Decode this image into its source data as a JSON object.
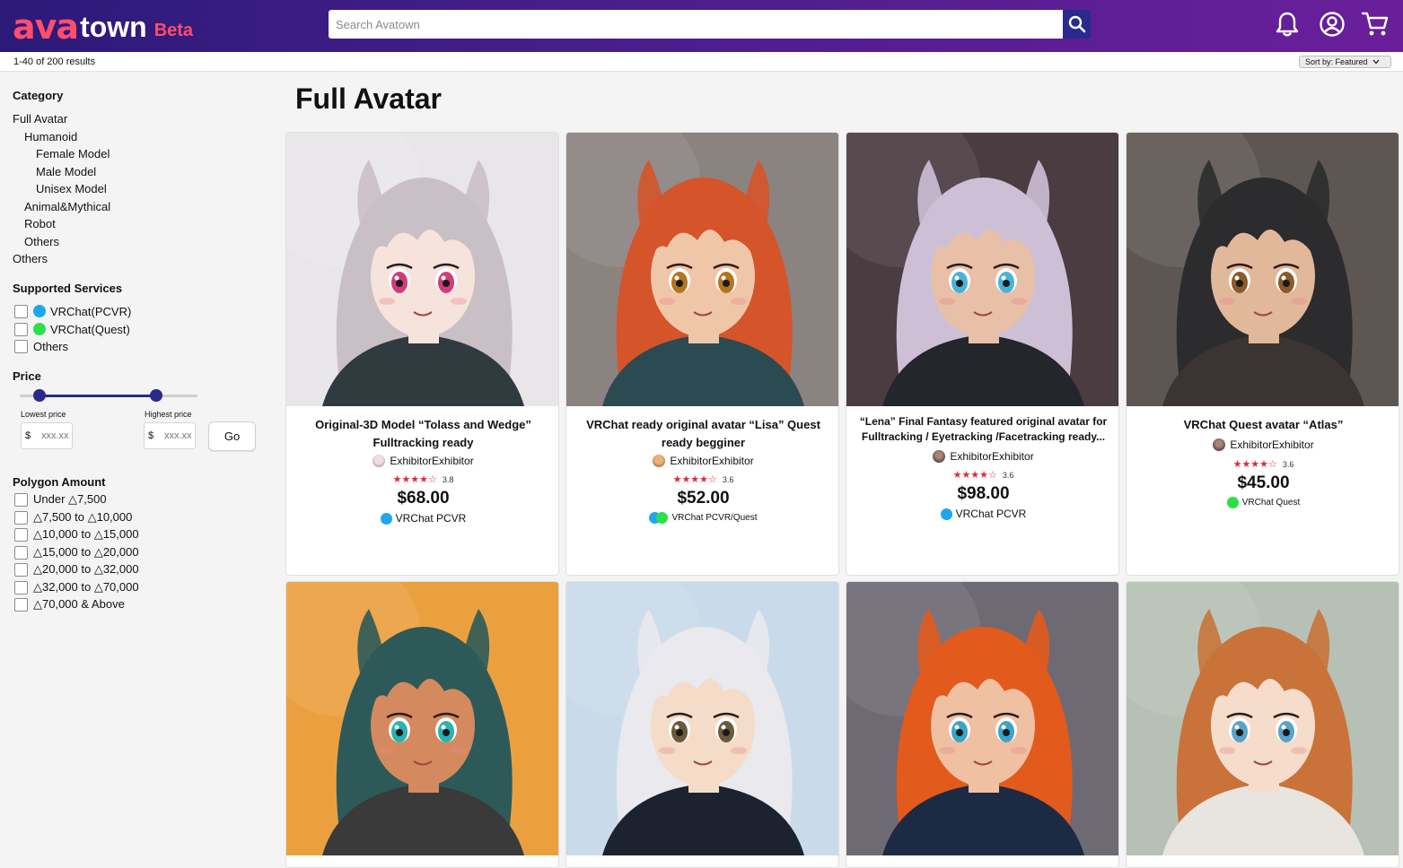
{
  "header": {
    "logo_ava": "ava",
    "logo_town": "town",
    "logo_beta": "Beta",
    "search_placeholder": "Search Avatown",
    "icons": [
      "search-icon",
      "bell-icon",
      "account-icon",
      "cart-icon"
    ]
  },
  "results": {
    "count_text": "1-40 of 200 results",
    "sort_label": "Sort by: Featured"
  },
  "sidebar": {
    "category_heading": "Category",
    "categories": [
      {
        "label": "Full Avatar",
        "level": 0
      },
      {
        "label": "Humanoid",
        "level": 1
      },
      {
        "label": "Female Model",
        "level": 2
      },
      {
        "label": "Male Model",
        "level": 2
      },
      {
        "label": "Unisex Model",
        "level": 2
      },
      {
        "label": "Animal&Mythical",
        "level": 1
      },
      {
        "label": "Robot",
        "level": 1
      },
      {
        "label": "Others",
        "level": 1
      },
      {
        "label": "Others",
        "level": 0
      }
    ],
    "services_heading": "Supported Services",
    "services": [
      {
        "label": "VRChat(PCVR)",
        "color": "#1ea7ef"
      },
      {
        "label": "VRChat(Quest)",
        "color": "#2be04a"
      },
      {
        "label": "Others",
        "color": ""
      }
    ],
    "price_heading": "Price",
    "price_slider": {
      "low_fraction": 0.11,
      "high_fraction": 0.77
    },
    "lowest_price_label": "Lowest price",
    "highest_price_label": "Highest price",
    "currency": "$",
    "price_placeholder": "xxx.xx",
    "go_label": "Go",
    "polygon_heading": "Polygon Amount",
    "polygons": [
      "Under △7,500",
      "△7,500 to △10,000",
      "△10,000 to △15,000",
      "△15,000 to △20,000",
      "△20,000 to △32,000",
      "△32,000 to △70,000",
      "△70,000 & Above"
    ]
  },
  "main": {
    "page_title": "Full Avatar",
    "products": [
      {
        "title": "Original-3D Model “Tolass and Wedge” Fulltracking ready",
        "seller": "ExhibitorExhibitor",
        "rating": "3.8",
        "stars": "★★★★☆",
        "price": "$68.00",
        "service": "VRChat PCVR",
        "service_colors": [
          "#1ea7ef"
        ],
        "palette": {
          "bg": "#e9e6ea",
          "hair": "#c9c0c6",
          "skin": "#f6e3dc",
          "cloth": "#2f3b3e",
          "eye": "#d13d7a"
        }
      },
      {
        "title": "VRChat ready original avatar “Lisa” Quest ready begginer",
        "seller": "ExhibitorExhibitor",
        "rating": "3.6",
        "stars": "★★★★☆",
        "price": "$52.00",
        "service": "VRChat PCVR/Quest",
        "service_colors": [
          "#1ea7ef",
          "#2be04a"
        ],
        "palette": {
          "bg": "#8a8380",
          "hair": "#d5542a",
          "skin": "#f0c6a8",
          "cloth": "#2c4a52",
          "eye": "#b5741f"
        }
      },
      {
        "title": "“Lena” Final Fantasy featured original avatar for Fulltracking / Eyetracking /Facetracking ready...",
        "seller": "ExhibitorExhibitor",
        "rating": "3.6",
        "stars": "★★★★☆",
        "price": "$98.00",
        "service": "VRChat PCVR",
        "service_colors": [
          "#1ea7ef"
        ],
        "palette": {
          "bg": "#4a3c40",
          "hair": "#cdbfd6",
          "skin": "#e8c0a8",
          "cloth": "#23262b",
          "eye": "#48b3d9"
        }
      },
      {
        "title": "VRChat Quest avatar “Atlas”",
        "seller": "ExhibitorExhibitor",
        "rating": "3.6",
        "stars": "★★★★☆",
        "price": "$45.00",
        "service": "VRChat Quest",
        "service_colors": [
          "#2be04a"
        ],
        "palette": {
          "bg": "#5e5652",
          "hair": "#2c2c2e",
          "skin": "#e2b89b",
          "cloth": "#3a3533",
          "eye": "#8a5a2a"
        }
      },
      {
        "title": "",
        "palette": {
          "bg": "#eba040",
          "hair": "#2d5a58",
          "skin": "#d48a5e",
          "cloth": "#3a3a3a",
          "eye": "#2ab3b0"
        }
      },
      {
        "title": "",
        "palette": {
          "bg": "#c9dbea",
          "hair": "#e9e9ee",
          "skin": "#f4dcc9",
          "cloth": "#1d2230",
          "eye": "#6b5a3a"
        }
      },
      {
        "title": "",
        "palette": {
          "bg": "#6e6a74",
          "hair": "#e25a1c",
          "skin": "#efc0a2",
          "cloth": "#1d2a44",
          "eye": "#3aa5c8"
        }
      },
      {
        "title": "",
        "palette": {
          "bg": "#b7c0b4",
          "hair": "#c9733a",
          "skin": "#f6dcca",
          "cloth": "#e8e4df",
          "eye": "#5aa3c8"
        }
      }
    ]
  }
}
